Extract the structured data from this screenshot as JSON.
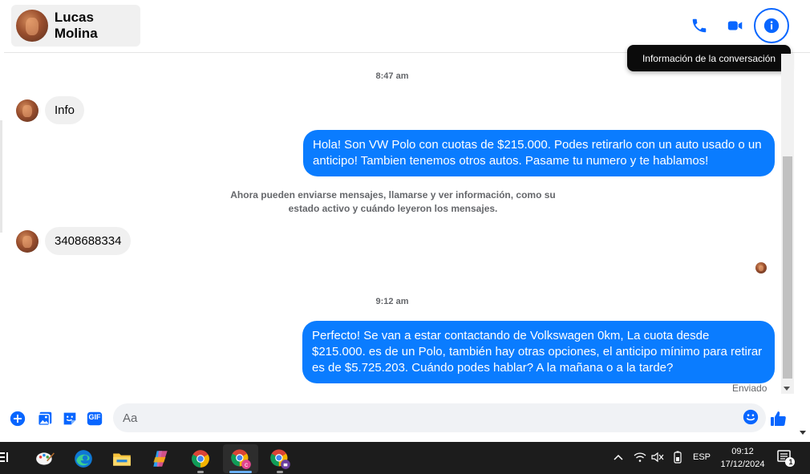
{
  "header": {
    "contact_name": "Lucas Molina",
    "tooltip": "Información de la conversación",
    "icons": [
      "phone-icon",
      "video-icon",
      "info-icon"
    ]
  },
  "messages": {
    "time_1": "8:47 am",
    "incoming_1": "Info",
    "outgoing_1": "Hola! Son VW Polo con cuotas de $215.000. Podes retirarlo con un auto usado o un anticipo! Tambien tenemos otros autos. Pasame tu numero y te hablamos!",
    "system_note": "Ahora pueden enviarse mensajes, llamarse y ver información, como su estado activo y cuándo leyeron los mensajes.",
    "incoming_2": "3408688334",
    "time_2": "9:12 am",
    "outgoing_2": "Perfecto!  Se van a estar contactando de Volkswagen 0km, La cuota desde $215.000. es de un Polo, también hay otras opciones, el anticipo mínimo para retirar es de $5.725.203. Cuándo podes hablar? A la mañana o a la tarde?",
    "status": "Enviado"
  },
  "composer": {
    "placeholder": "Aa",
    "gif_label": "GIF",
    "icons": [
      "add-icon",
      "photo-icon",
      "sticker-icon",
      "gif-icon",
      "emoji-icon",
      "like-icon"
    ]
  },
  "taskbar": {
    "language": "ESP",
    "time": "09:12",
    "date": "17/12/2024",
    "notification_count": "1",
    "apps": [
      "paint-icon",
      "edge-icon",
      "file-explorer-icon",
      "copilot-icon",
      "chrome-icon",
      "chrome-profile-c-icon",
      "chrome-profile-lock-icon"
    ]
  },
  "colors": {
    "accent": "#0866ff",
    "outgoing_bubble": "#0a7cff",
    "incoming_bubble": "#f0f0f0",
    "taskbar": "#1c1c1c"
  }
}
